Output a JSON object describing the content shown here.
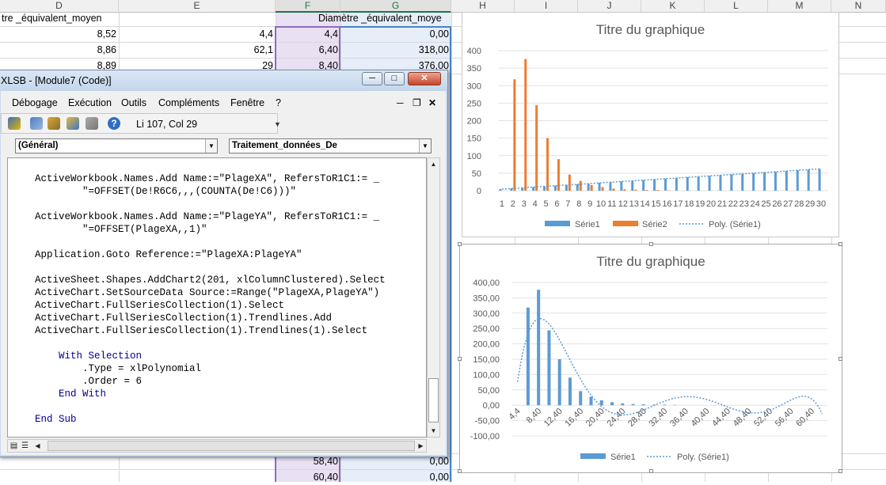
{
  "sheet": {
    "columns": [
      "D",
      "E",
      "F",
      "G",
      "H",
      "I",
      "J",
      "K",
      "L",
      "M",
      "N"
    ],
    "header_d": "tre _équivalent_moyen",
    "header_g": "Diamètre _équivalent_moye",
    "rows": [
      {
        "d": "8,52",
        "e": "4,4",
        "f": "4,4",
        "g": "0,00"
      },
      {
        "d": "8,86",
        "e": "62,1",
        "f": "6,40",
        "g": "318,00"
      },
      {
        "d": "8,89",
        "e": "29",
        "f": "8,40",
        "g": "376,00"
      },
      {
        "f": "58,40",
        "g": "0,00"
      },
      {
        "f": "60,40",
        "g": "0,00"
      }
    ]
  },
  "vba": {
    "title": "XLSB - [Module7 (Code)]",
    "menu": [
      "Débogage",
      "Exécution",
      "Outils",
      "Compléments",
      "Fenêtre",
      "?"
    ],
    "position": "Li 107, Col 29",
    "combo_left": "(Général)",
    "combo_right": "Traitement_données_De",
    "code_lines": [
      "ActiveWorkbook.Names.Add Name:=\"PlageXA\", RefersToR1C1:= _",
      "        \"=OFFSET(De!R6C6,,,(COUNTA(De!C6)))\"",
      "",
      "ActiveWorkbook.Names.Add Name:=\"PlageYA\", RefersToR1C1:= _",
      "        \"=OFFSET(PlageXA,,1)\"",
      "",
      "Application.Goto Reference:=\"PlageXA:PlageYA\"",
      "",
      "ActiveSheet.Shapes.AddChart2(201, xlColumnClustered).Select",
      "ActiveChart.SetSourceData Source:=Range(\"PlageXA,PlageYA\")",
      "ActiveChart.FullSeriesCollection(1).Select",
      "ActiveChart.FullSeriesCollection(1).Trendlines.Add",
      "ActiveChart.FullSeriesCollection(1).Trendlines(1).Select",
      "",
      "    With Selection",
      "        .Type = xlPolynomial",
      "        .Order = 6",
      "    End With",
      "",
      "End Sub"
    ]
  },
  "chart_data": [
    {
      "type": "bar",
      "title": "Titre du graphique",
      "categories": [
        "1",
        "2",
        "3",
        "4",
        "5",
        "6",
        "7",
        "8",
        "9",
        "10",
        "11",
        "12",
        "13",
        "14",
        "15",
        "16",
        "17",
        "18",
        "19",
        "20",
        "21",
        "22",
        "23",
        "24",
        "25",
        "26",
        "27",
        "28",
        "29",
        "30"
      ],
      "ylim": [
        0,
        400
      ],
      "yticks": [
        "0",
        "50",
        "100",
        "150",
        "200",
        "250",
        "300",
        "350",
        "400"
      ],
      "series": [
        {
          "name": "Série1",
          "color": "#5b9bd5",
          "values": [
            4.4,
            6.4,
            8.4,
            10.4,
            12.4,
            14.4,
            16.4,
            18.4,
            20.4,
            22.4,
            24.4,
            26.4,
            28.4,
            30.4,
            32.4,
            34.4,
            36.4,
            38.4,
            40.4,
            42.4,
            44.4,
            46.4,
            48.4,
            50.4,
            52.4,
            54.4,
            56.4,
            58.4,
            60.4,
            62.4
          ]
        },
        {
          "name": "Série2",
          "color": "#ed7d31",
          "values": [
            0,
            318,
            376,
            244,
            150,
            90,
            46,
            28,
            16,
            10,
            6,
            4,
            3,
            2,
            2,
            1,
            0,
            0,
            0,
            0,
            0,
            0,
            0,
            0,
            0,
            0,
            0,
            0,
            0,
            0
          ]
        }
      ],
      "trendline": {
        "name": "Poly. (Série1)",
        "color": "#5b9bd5"
      },
      "legend": "bottom"
    },
    {
      "type": "bar",
      "title": "Titre du graphique",
      "categories": [
        "4,4",
        "8,40",
        "12,40",
        "16,40",
        "20,40",
        "24,40",
        "28,40",
        "32,40",
        "36,40",
        "40,40",
        "44,40",
        "48,40",
        "52,40",
        "56,40",
        "60,40"
      ],
      "ylim": [
        -100,
        400
      ],
      "yticks": [
        "-100,00",
        "-50,00",
        "0,00",
        "50,00",
        "100,00",
        "150,00",
        "200,00",
        "250,00",
        "300,00",
        "350,00",
        "400,00"
      ],
      "series": [
        {
          "name": "Série1",
          "color": "#5b9bd5",
          "values": [
            0,
            318,
            376,
            244,
            150,
            90,
            46,
            28,
            16,
            10,
            6,
            4,
            3,
            2,
            2,
            1,
            0,
            0,
            0,
            0,
            0,
            0,
            0,
            0,
            0,
            0,
            0,
            0,
            0,
            0
          ]
        }
      ],
      "trendline": {
        "name": "Poly. (Série1)",
        "color": "#5b9bd5"
      },
      "legend": "bottom"
    }
  ]
}
